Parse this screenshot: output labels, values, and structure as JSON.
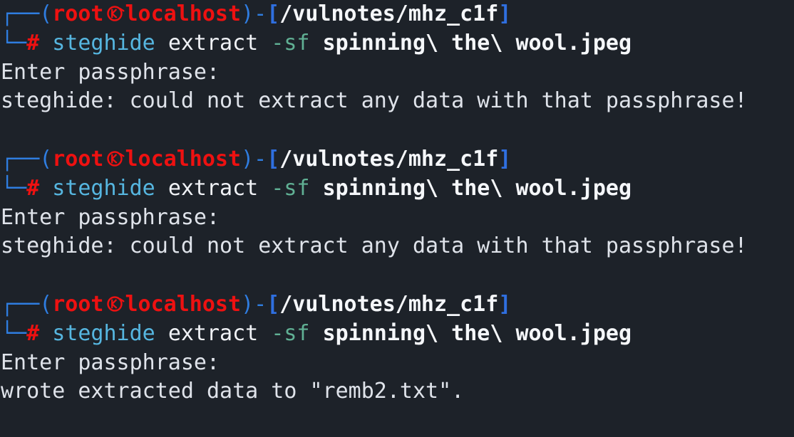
{
  "terminal": {
    "background": "#1d2229",
    "foreground": "#dfe3ea",
    "prompt": {
      "frame_top": "┌──",
      "frame_bottom": "└─",
      "open_paren": "(",
      "user": "root",
      "kali_glyph": "㉿",
      "host": "localhost",
      "close_paren": ")",
      "dash": "-",
      "open_bracket": "[",
      "path": "/vulnotes/mhz_c1f",
      "close_bracket": "]",
      "symbol": "#"
    },
    "command": {
      "program": "steghide",
      "subcommand": "extract",
      "flag": "-sf",
      "argument": "spinning\\ the\\ wool.jpeg"
    },
    "blocks": [
      {
        "output": [
          "Enter passphrase:",
          "steghide: could not extract any data with that passphrase!"
        ]
      },
      {
        "output": [
          "Enter passphrase:",
          "steghide: could not extract any data with that passphrase!"
        ]
      },
      {
        "output": [
          "Enter passphrase:",
          "wrote extracted data to \"remb2.txt\"."
        ]
      }
    ],
    "colors": {
      "red": "#ee1111",
      "blue": "#2f7de0",
      "bracket_blue": "#2f6fe0",
      "cmd_blue": "#56b6e0",
      "flag_green": "#60b094",
      "white": "#f5f7fa"
    }
  }
}
